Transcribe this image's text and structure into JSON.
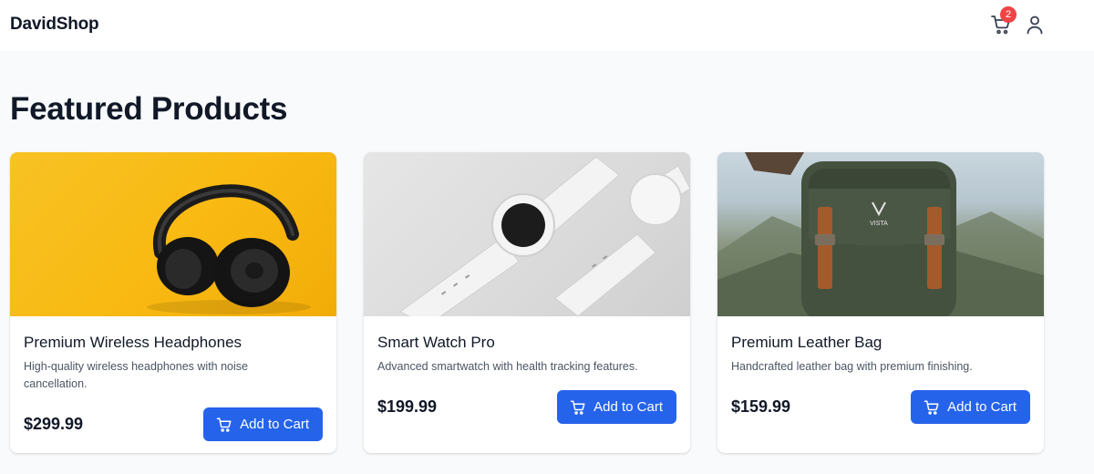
{
  "app": {
    "brand": "DavidShop"
  },
  "header": {
    "cart_count": "2"
  },
  "main": {
    "title": "Featured Products",
    "products": [
      {
        "name": "Premium Wireless Headphones",
        "description": "High-quality wireless headphones with noise cancellation.",
        "price": "$299.99",
        "cta": "Add to Cart",
        "image": "headphones-on-yellow"
      },
      {
        "name": "Smart Watch Pro",
        "description": "Advanced smartwatch with health tracking features.",
        "price": "$199.99",
        "cta": "Add to Cart",
        "image": "white-smartwatch"
      },
      {
        "name": "Premium Leather Bag",
        "description": "Handcrafted leather bag with premium finishing.",
        "price": "$159.99",
        "cta": "Add to Cart",
        "image": "green-backpack-mountains"
      }
    ]
  },
  "colors": {
    "primary": "#2563eb",
    "badge": "#ef4444",
    "background": "#f8fafc",
    "text": "#111827",
    "muted": "#4b5563"
  }
}
